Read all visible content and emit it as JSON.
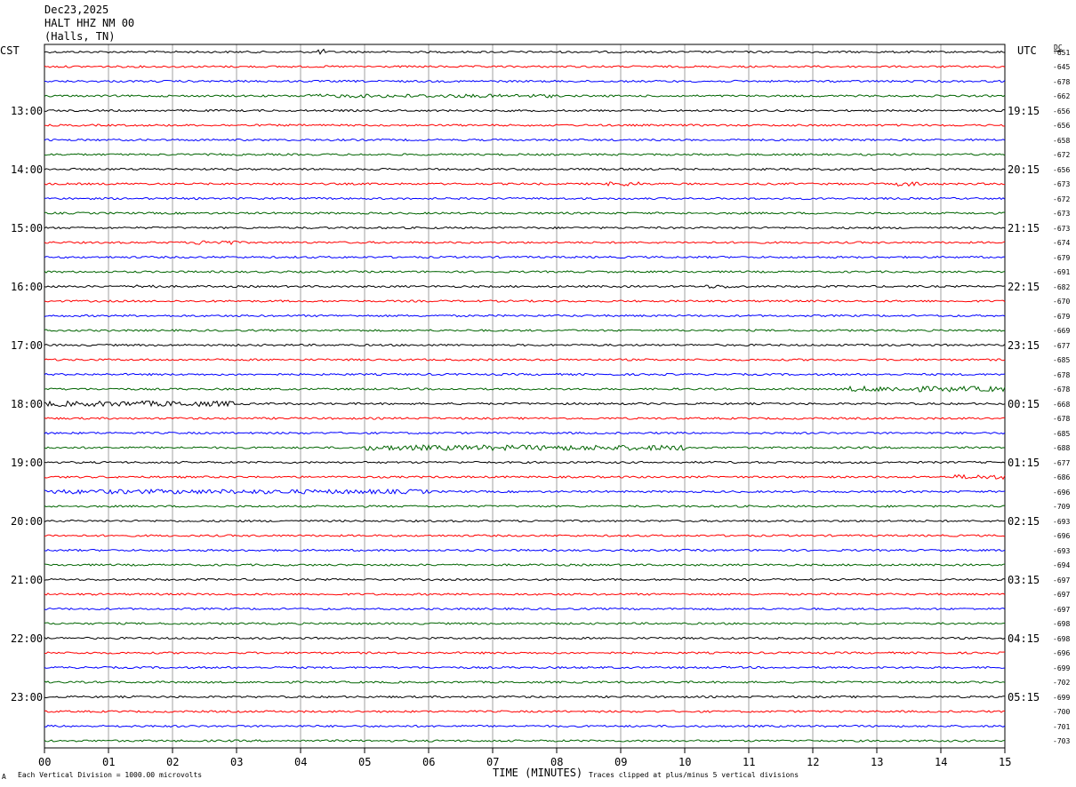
{
  "header": {
    "date": "Dec23,2025",
    "station": "HALT HHZ NM 00",
    "location": "(Halls, TN)"
  },
  "left_axis_title": "CST",
  "right_axis_title": "UTC",
  "dc_title": "DC",
  "footer": {
    "scale_note": "Each Vertical Division = 1000.00 microvolts",
    "x_axis_title": "TIME (MINUTES)",
    "clip_note": "Traces clipped at plus/minus 5 vertical divisions",
    "corner_mark": "A"
  },
  "colors": {
    "trace_cycle": [
      "#000000",
      "#ff0000",
      "#0000ff",
      "#006400"
    ],
    "grid": "#a0a0a0",
    "frame": "#000000"
  },
  "chart_data": {
    "type": "line",
    "title": "",
    "xlabel": "TIME (MINUTES)",
    "ylabel": "",
    "x_range": [
      0,
      15
    ],
    "x_ticks": [
      "00",
      "01",
      "02",
      "03",
      "04",
      "05",
      "06",
      "07",
      "08",
      "09",
      "10",
      "11",
      "12",
      "13",
      "14",
      "15"
    ],
    "row_minutes": 15,
    "row_count": 48,
    "cst_hour_labels": [
      "13:00",
      "14:00",
      "15:00",
      "16:00",
      "17:00",
      "18:00",
      "19:00",
      "20:00",
      "21:00",
      "22:00",
      "23:00"
    ],
    "utc_hour_labels": [
      "19:15",
      "20:15",
      "21:15",
      "22:15",
      "23:15",
      "00:15",
      "01:15",
      "02:15",
      "03:15",
      "04:15",
      "05:15"
    ],
    "dc_offsets": [
      -651,
      -645,
      -678,
      -662,
      -656,
      -656,
      -658,
      -672,
      -656,
      -673,
      -672,
      -673,
      -673,
      -674,
      -679,
      -691,
      -682,
      -670,
      -679,
      -669,
      -677,
      -685,
      -678,
      -678,
      -668,
      -678,
      -685,
      -688,
      -677,
      -686,
      -696,
      -709,
      -693,
      -696,
      -693,
      -694,
      -697,
      -697,
      -697,
      -698,
      -698,
      -696,
      -699,
      -702,
      -699,
      -700,
      -701,
      -703
    ],
    "scale_microvolts_per_division": 1000.0,
    "clip_divisions": 5
  }
}
